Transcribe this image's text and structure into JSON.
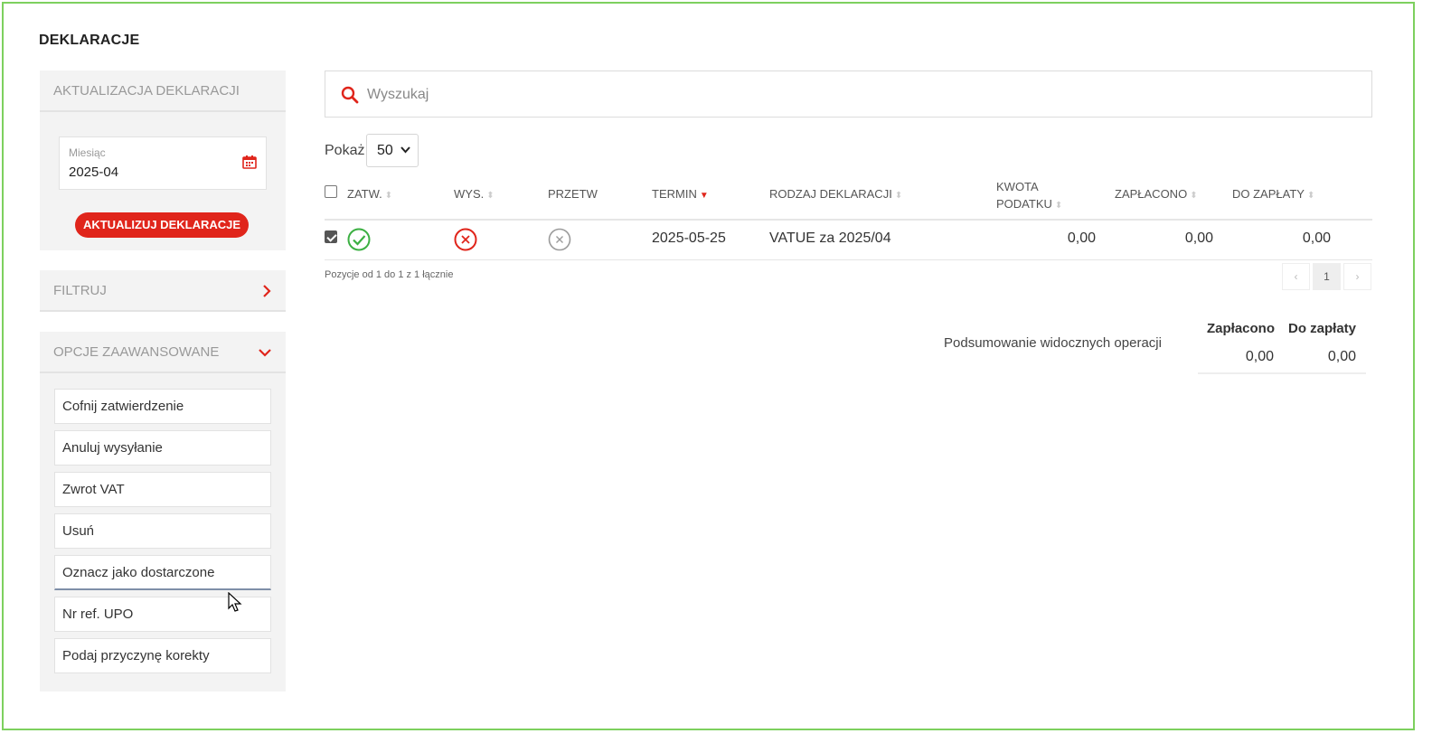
{
  "page_title": "DEKLARACJE",
  "sidebar": {
    "update_panel": {
      "title": "AKTUALIZACJA DEKLARACJI",
      "month_label": "Miesiąc",
      "month_value": "2025-04",
      "button": "AKTUALIZUJ DEKLARACJE"
    },
    "filter_panel": {
      "title": "FILTRUJ"
    },
    "advanced_panel": {
      "title": "OPCJE ZAAWANSOWANE",
      "options": [
        "Cofnij zatwierdzenie",
        "Anuluj wysyłanie",
        "Zwrot VAT",
        "Usuń",
        "Oznacz jako dostarczone",
        "Nr ref. UPO",
        "Podaj przyczynę korekty"
      ]
    }
  },
  "search": {
    "placeholder": "Wyszukaj"
  },
  "show": {
    "label": "Pokaż",
    "value": "50"
  },
  "table": {
    "headers": {
      "zatw": "ZATW.",
      "wys": "WYS.",
      "przetw": "PRZETW",
      "termin": "TERMIN",
      "rodzaj": "RODZAJ DEKLARACJI",
      "kwota_1": "KWOTA",
      "kwota_2": "PODATKU",
      "zaplacono": "ZAPŁACONO",
      "do_zaplaty": "DO ZAPŁATY"
    },
    "rows": [
      {
        "checked": true,
        "zatw": "approved",
        "wys": "error",
        "przetw": "not-processed",
        "termin": "2025-05-25",
        "rodzaj": "VATUE za 2025/04",
        "kwota": "0,00",
        "zaplacono": "0,00",
        "do_zaplaty": "0,00"
      }
    ],
    "info": "Pozycje od 1 do 1 z 1 łącznie",
    "pagination": {
      "prev": "‹",
      "current": "1",
      "next": "›"
    }
  },
  "summary": {
    "label": "Podsumowanie widocznych operacji",
    "zaplacono_header": "Zapłacono",
    "do_zaplaty_header": "Do zapłaty",
    "zaplacono_value": "0,00",
    "do_zaplaty_value": "0,00"
  },
  "colors": {
    "accent": "#e0251b",
    "success": "#3cb043",
    "frame": "#7dd05e",
    "muted": "#999999"
  }
}
